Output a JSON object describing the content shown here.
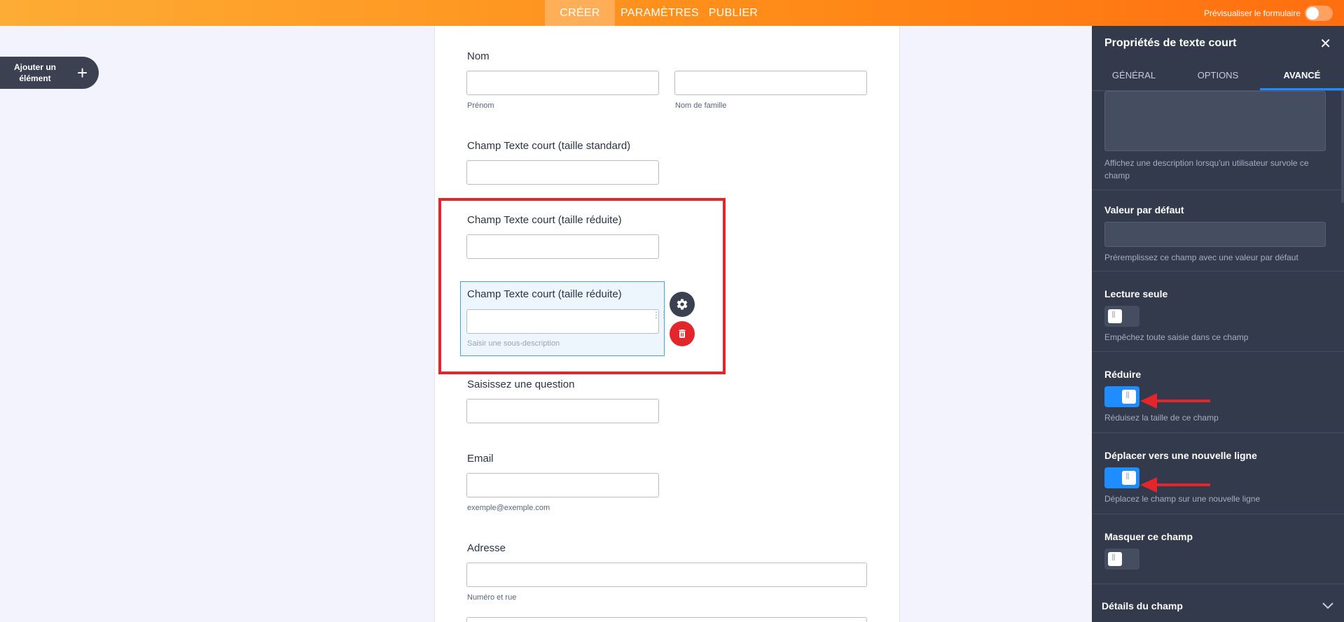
{
  "topbar": {
    "tabs": [
      "CRÉER",
      "PARAMÈTRES",
      "PUBLIER"
    ],
    "preview_label": "Prévisualiser le formulaire"
  },
  "add_element": {
    "label": "Ajouter un élément",
    "icon": "plus-icon"
  },
  "form": {
    "name": {
      "label": "Nom",
      "first_sublabel": "Prénom",
      "last_sublabel": "Nom de famille"
    },
    "standard": {
      "label": "Champ Texte court (taille standard)"
    },
    "reduced1": {
      "label": "Champ Texte court (taille réduite)"
    },
    "reduced2": {
      "label": "Champ Texte court (taille réduite)",
      "sublabel_placeholder": "Saisir une sous-description"
    },
    "question": {
      "label": "Saisissez une question"
    },
    "email": {
      "label": "Email",
      "sublabel": "exemple@exemple.com"
    },
    "address": {
      "label": "Adresse",
      "sublabel": "Numéro et rue"
    }
  },
  "panel": {
    "title": "Propriétés de texte court",
    "tabs": [
      "GÉNÉRAL",
      "OPTIONS",
      "AVANCÉ"
    ],
    "active_tab": "AVANCÉ",
    "hover_desc": "Affichez une description lorsqu'un utilisateur survole ce champ",
    "default_value": {
      "title": "Valeur par défaut",
      "desc": "Préremplissez ce champ avec une valeur par défaut"
    },
    "read_only": {
      "title": "Lecture seule",
      "desc": "Empêchez toute saisie dans ce champ",
      "on": false
    },
    "shrink": {
      "title": "Réduire",
      "desc": "Réduisez la taille de ce champ",
      "on": true
    },
    "new_line": {
      "title": "Déplacer vers une nouvelle ligne",
      "desc": "Déplacez le champ sur une nouvelle ligne",
      "on": true
    },
    "hide": {
      "title": "Masquer ce champ",
      "on": false
    },
    "details": {
      "title": "Détails du champ"
    }
  },
  "colors": {
    "accent_orange": "#ff8a17",
    "highlight_red": "#e3262c",
    "toggle_on": "#1f8cff",
    "panel_bg": "#333a4b"
  }
}
